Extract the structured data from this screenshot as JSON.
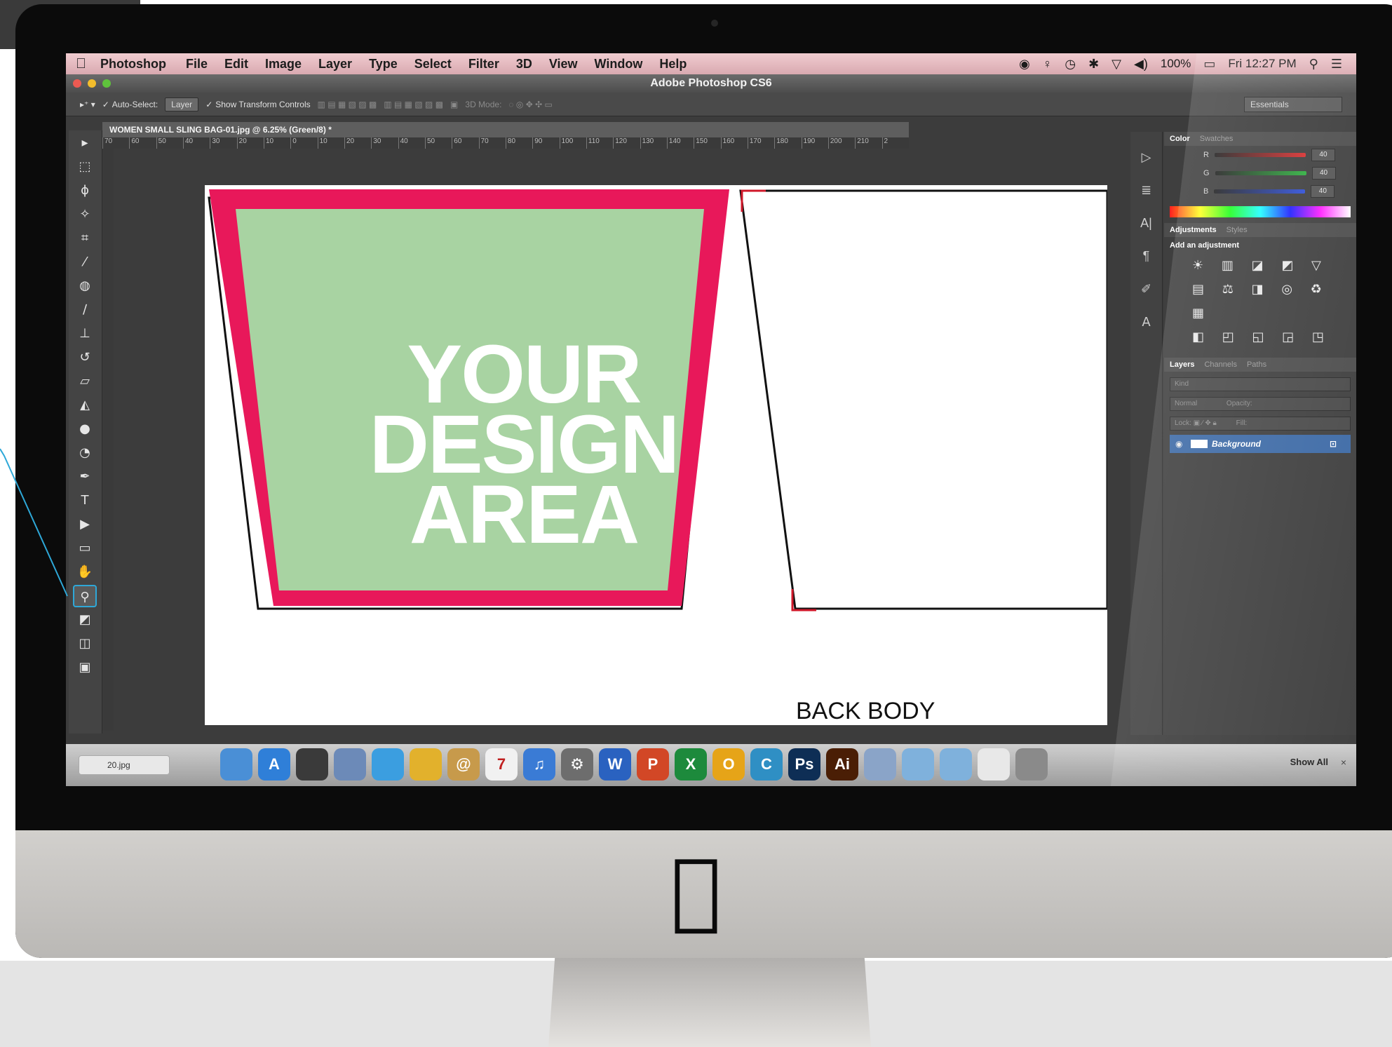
{
  "menubar": {
    "apple": "",
    "app_name": "Photoshop",
    "items": [
      "File",
      "Edit",
      "Image",
      "Layer",
      "Type",
      "Select",
      "Filter",
      "3D",
      "View",
      "Window",
      "Help"
    ],
    "battery": "100%",
    "clock": "Fri 12:27 PM"
  },
  "window": {
    "title": "Adobe Photoshop CS6"
  },
  "options_bar": {
    "auto_select": "Auto-Select:",
    "layer_select": "Layer",
    "show_transform": "Show Transform Controls",
    "mode_3d": "3D Mode:",
    "workspace": "Essentials"
  },
  "document": {
    "tab_title": "WOMEN SMALL SLING BAG-01.jpg @ 6.25% (Green/8) *",
    "ruler_ticks": [
      "70",
      "60",
      "50",
      "40",
      "30",
      "20",
      "10",
      "0",
      "10",
      "20",
      "30",
      "40",
      "50",
      "60",
      "70",
      "80",
      "90",
      "100",
      "110",
      "120",
      "130",
      "140",
      "150",
      "160",
      "170",
      "180",
      "190",
      "200",
      "210",
      "2"
    ],
    "design_area_lines": [
      "YOUR",
      "DESIGN",
      "AREA"
    ],
    "back_label": "BACK BODY",
    "colors": {
      "border": "#e8185a",
      "fill": "#a8d3a2"
    }
  },
  "tools": [
    {
      "name": "move-tool-icon",
      "glyph": "▸"
    },
    {
      "name": "marquee-tool-icon",
      "glyph": "⬚"
    },
    {
      "name": "lasso-tool-icon",
      "glyph": "ϕ"
    },
    {
      "name": "magic-wand-tool-icon",
      "glyph": "✧"
    },
    {
      "name": "crop-tool-icon",
      "glyph": "⌗"
    },
    {
      "name": "eyedropper-tool-icon",
      "glyph": "⁄"
    },
    {
      "name": "healing-brush-tool-icon",
      "glyph": "◍"
    },
    {
      "name": "brush-tool-icon",
      "glyph": "∕"
    },
    {
      "name": "clone-stamp-tool-icon",
      "glyph": "⊥"
    },
    {
      "name": "history-brush-tool-icon",
      "glyph": "↺"
    },
    {
      "name": "eraser-tool-icon",
      "glyph": "▱"
    },
    {
      "name": "paint-bucket-tool-icon",
      "glyph": "◭"
    },
    {
      "name": "blur-tool-icon",
      "glyph": "●"
    },
    {
      "name": "dodge-tool-icon",
      "glyph": "◔"
    },
    {
      "name": "pen-tool-icon",
      "glyph": "✒"
    },
    {
      "name": "type-tool-icon",
      "glyph": "T"
    },
    {
      "name": "path-selection-tool-icon",
      "glyph": "▶"
    },
    {
      "name": "shape-tool-icon",
      "glyph": "▭"
    },
    {
      "name": "hand-tool-icon",
      "glyph": "✋"
    },
    {
      "name": "zoom-tool-icon",
      "glyph": "⚲"
    },
    {
      "name": "color-swatches-icon",
      "glyph": "◩"
    },
    {
      "name": "quick-mask-icon",
      "glyph": "◫"
    },
    {
      "name": "screen-mode-icon",
      "glyph": "▣"
    }
  ],
  "panels": {
    "color_tabs": [
      "Color",
      "Swatches"
    ],
    "color_channels": [
      {
        "label": "R",
        "value": "40",
        "color": "#d83030"
      },
      {
        "label": "G",
        "value": "40",
        "color": "#30b040"
      },
      {
        "label": "B",
        "value": "40",
        "color": "#3050d8"
      }
    ],
    "adjust_tabs": [
      "Adjustments",
      "Styles"
    ],
    "add_adjustment": "Add an adjustment",
    "adjust_icons_rows": [
      "☀ ▥ ◪ ◩ ▽",
      "▤ ⚖ ◨ ◎ ♻ ▦",
      "◧ ◰ ◱ ◲ ◳"
    ],
    "layer_tabs": [
      "Layers",
      "Channels",
      "Paths"
    ],
    "kind_filter": "Kind",
    "blend_mode": "Normal",
    "opacity_label": "Opacity:",
    "lock_label": "Lock:",
    "fill_label": "Fill:",
    "layer_name": "Background"
  },
  "dock": {
    "file_name": "20.jpg",
    "apps": [
      {
        "name": "finder-icon",
        "color": "#4a8fd6",
        "label": ""
      },
      {
        "name": "app-store-icon",
        "color": "#2f7fd8",
        "label": "A"
      },
      {
        "name": "dashboard-icon",
        "color": "#3a3a3a",
        "label": ""
      },
      {
        "name": "mail-icon",
        "color": "#6c8ab8",
        "label": ""
      },
      {
        "name": "safari-icon",
        "color": "#3b9ee0",
        "label": ""
      },
      {
        "name": "chrome-icon",
        "color": "#e2b12c",
        "label": ""
      },
      {
        "name": "contacts-icon",
        "color": "#c79a4b",
        "label": "@"
      },
      {
        "name": "calendar-icon",
        "color": "#f1f1f1",
        "label": "7"
      },
      {
        "name": "itunes-icon",
        "color": "#3a7bd5",
        "label": "♫"
      },
      {
        "name": "system-preferences-icon",
        "color": "#6d6d6d",
        "label": "⚙"
      },
      {
        "name": "word-icon",
        "color": "#2a62c0",
        "label": "W"
      },
      {
        "name": "powerpoint-icon",
        "color": "#d24726",
        "label": "P"
      },
      {
        "name": "excel-icon",
        "color": "#1d8a3c",
        "label": "X"
      },
      {
        "name": "outlook-icon",
        "color": "#e6a418",
        "label": "O"
      },
      {
        "name": "communicator-icon",
        "color": "#2f8fc4",
        "label": "C"
      },
      {
        "name": "photoshop-icon",
        "color": "#0e2e55",
        "label": "Ps"
      },
      {
        "name": "illustrator-icon",
        "color": "#4a1e05",
        "label": "Ai"
      },
      {
        "name": "preview-icon",
        "color": "#8aa4c8",
        "label": ""
      },
      {
        "name": "applications-folder-icon",
        "color": "#7fb1dc",
        "label": ""
      },
      {
        "name": "documents-folder-icon",
        "color": "#7fb1dc",
        "label": ""
      },
      {
        "name": "downloads-stack-icon",
        "color": "#e8e8e8",
        "label": ""
      },
      {
        "name": "trash-icon",
        "color": "#8a8a8a",
        "label": ""
      }
    ],
    "show_all": "Show All"
  }
}
